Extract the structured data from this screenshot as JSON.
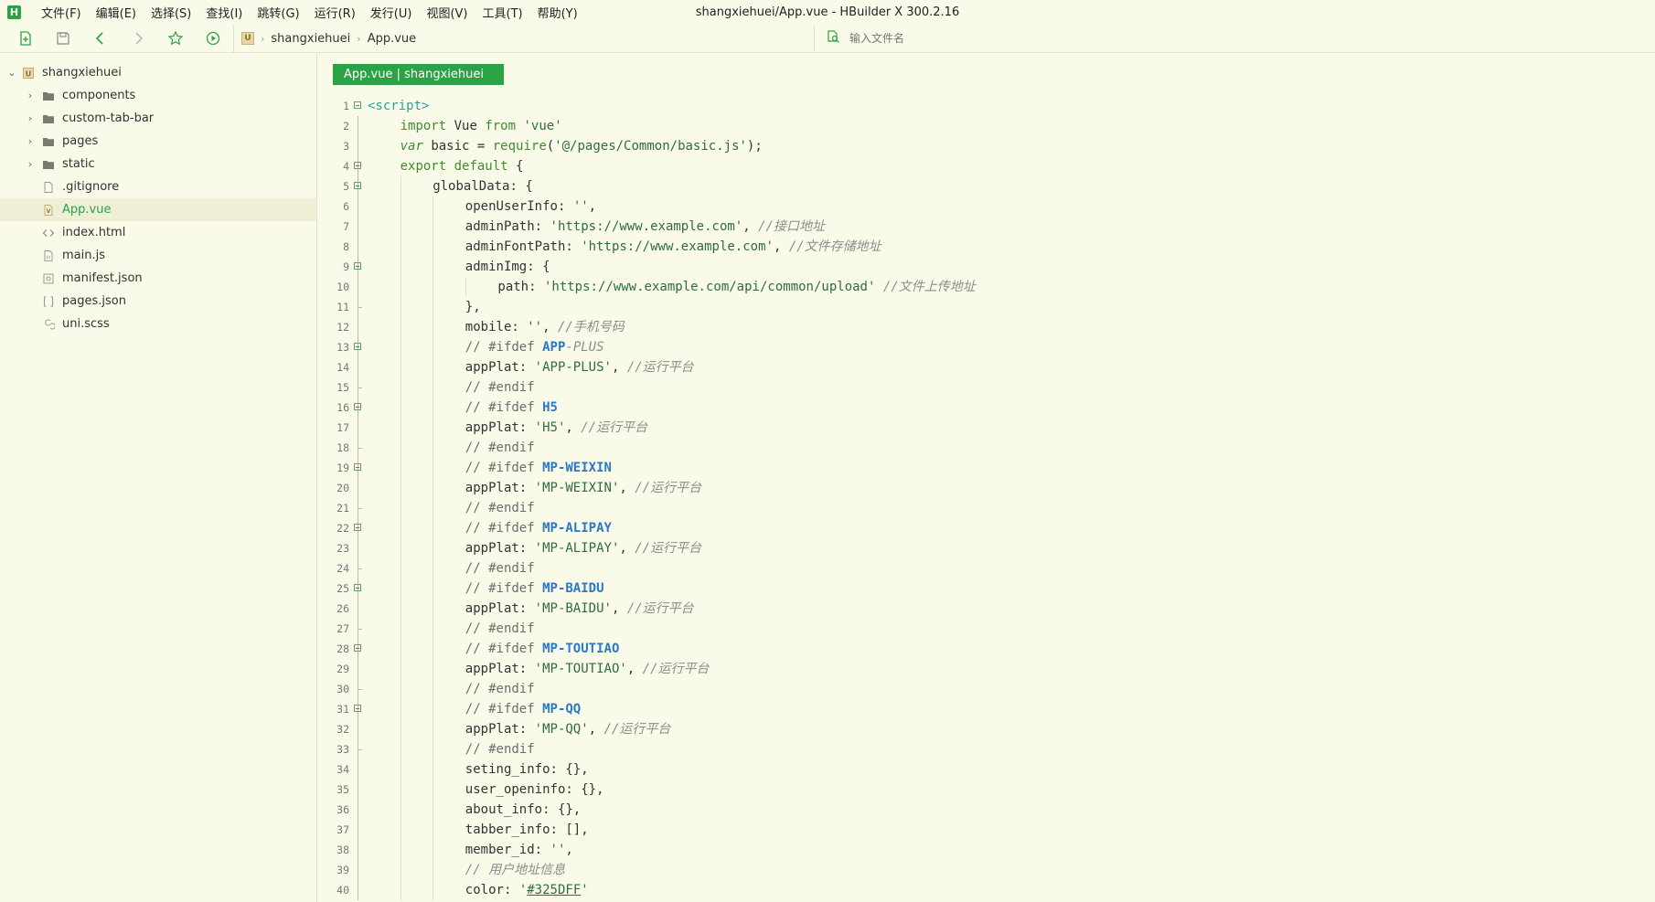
{
  "window": {
    "title": "shangxiehuei/App.vue - HBuilder X 300.2.16",
    "app_logo": "H"
  },
  "menu": [
    "文件(F)",
    "编辑(E)",
    "选择(S)",
    "查找(I)",
    "跳转(G)",
    "运行(R)",
    "发行(U)",
    "视图(V)",
    "工具(T)",
    "帮助(Y)"
  ],
  "toolbar": {
    "breadcrumb": [
      "shangxiehuei",
      "App.vue"
    ],
    "file_search_placeholder": "输入文件名",
    "icons": [
      "new-file-icon",
      "save-icon",
      "back-icon",
      "forward-icon",
      "star-icon",
      "run-icon"
    ]
  },
  "sidebar": {
    "root": "shangxiehuei",
    "items": [
      {
        "label": "components",
        "type": "folder"
      },
      {
        "label": "custom-tab-bar",
        "type": "folder"
      },
      {
        "label": "pages",
        "type": "folder"
      },
      {
        "label": "static",
        "type": "folder"
      },
      {
        "label": ".gitignore",
        "type": "file"
      },
      {
        "label": "App.vue",
        "type": "vue",
        "selected": true
      },
      {
        "label": "index.html",
        "type": "html"
      },
      {
        "label": "main.js",
        "type": "js"
      },
      {
        "label": "manifest.json",
        "type": "json"
      },
      {
        "label": "pages.json",
        "type": "brackets"
      },
      {
        "label": "uni.scss",
        "type": "scss"
      }
    ]
  },
  "editor": {
    "tab_label": "App.vue | shangxiehuei",
    "lines": [
      {
        "n": "1",
        "indent": 0,
        "fold": "start",
        "parts": [
          {
            "t": "<script>",
            "c": "tag"
          }
        ]
      },
      {
        "n": "2",
        "indent": 1,
        "parts": [
          {
            "t": "import",
            "c": "kw"
          },
          {
            "t": " Vue ",
            "c": ""
          },
          {
            "t": "from",
            "c": "kw"
          },
          {
            "t": " 'vue'",
            "c": "str"
          }
        ]
      },
      {
        "n": "3",
        "indent": 1,
        "parts": [
          {
            "t": "var",
            "c": "kwi"
          },
          {
            "t": " basic = ",
            "c": ""
          },
          {
            "t": "require",
            "c": "kw"
          },
          {
            "t": "(",
            "c": ""
          },
          {
            "t": "'@/pages/Common/basic.js'",
            "c": "str"
          },
          {
            "t": ");",
            "c": ""
          }
        ]
      },
      {
        "n": "4",
        "indent": 1,
        "fold": "start",
        "parts": [
          {
            "t": "export default",
            "c": "kw"
          },
          {
            "t": " {",
            "c": ""
          }
        ]
      },
      {
        "n": "5",
        "indent": 2,
        "fold": "start",
        "parts": [
          {
            "t": "globalData: {",
            "c": ""
          }
        ]
      },
      {
        "n": "6",
        "indent": 3,
        "parts": [
          {
            "t": "openUserInfo: ",
            "c": ""
          },
          {
            "t": "''",
            "c": "str"
          },
          {
            "t": ",",
            "c": ""
          }
        ]
      },
      {
        "n": "7",
        "indent": 3,
        "parts": [
          {
            "t": "adminPath: ",
            "c": ""
          },
          {
            "t": "'https://www.example.com'",
            "c": "str"
          },
          {
            "t": ", ",
            "c": ""
          },
          {
            "t": "//接口地址",
            "c": "com"
          }
        ]
      },
      {
        "n": "8",
        "indent": 3,
        "parts": [
          {
            "t": "adminFontPath: ",
            "c": ""
          },
          {
            "t": "'https://www.example.com'",
            "c": "str"
          },
          {
            "t": ", ",
            "c": ""
          },
          {
            "t": "//文件存储地址",
            "c": "com"
          }
        ]
      },
      {
        "n": "9",
        "indent": 3,
        "fold": "start",
        "parts": [
          {
            "t": "adminImg: {",
            "c": ""
          }
        ]
      },
      {
        "n": "10",
        "indent": 4,
        "parts": [
          {
            "t": "path: ",
            "c": ""
          },
          {
            "t": "'https://www.example.com/api/common/upload'",
            "c": "str"
          },
          {
            "t": " ",
            "c": ""
          },
          {
            "t": "//文件上传地址",
            "c": "com"
          }
        ]
      },
      {
        "n": "11",
        "indent": 3,
        "fold": "end",
        "parts": [
          {
            "t": "},",
            "c": ""
          }
        ]
      },
      {
        "n": "12",
        "indent": 3,
        "parts": [
          {
            "t": "mobile: ",
            "c": ""
          },
          {
            "t": "''",
            "c": "str"
          },
          {
            "t": ", ",
            "c": ""
          },
          {
            "t": "//手机号码",
            "c": "com"
          }
        ]
      },
      {
        "n": "13",
        "indent": 3,
        "fold": "start",
        "parts": [
          {
            "t": "// #ifdef ",
            "c": "cpl"
          },
          {
            "t": "APP",
            "c": "bold"
          },
          {
            "t": "-PLUS",
            "c": "com"
          }
        ]
      },
      {
        "n": "14",
        "indent": 3,
        "parts": [
          {
            "t": "appPlat: ",
            "c": ""
          },
          {
            "t": "'APP-PLUS'",
            "c": "str"
          },
          {
            "t": ", ",
            "c": ""
          },
          {
            "t": "//运行平台",
            "c": "com"
          }
        ]
      },
      {
        "n": "15",
        "indent": 3,
        "fold": "end",
        "parts": [
          {
            "t": "// #endif",
            "c": "cpl"
          }
        ]
      },
      {
        "n": "16",
        "indent": 3,
        "fold": "start",
        "parts": [
          {
            "t": "// #ifdef ",
            "c": "cpl"
          },
          {
            "t": "H5",
            "c": "bold"
          }
        ]
      },
      {
        "n": "17",
        "indent": 3,
        "parts": [
          {
            "t": "appPlat: ",
            "c": ""
          },
          {
            "t": "'H5'",
            "c": "str"
          },
          {
            "t": ", ",
            "c": ""
          },
          {
            "t": "//运行平台",
            "c": "com"
          }
        ]
      },
      {
        "n": "18",
        "indent": 3,
        "fold": "end",
        "parts": [
          {
            "t": "// #endif",
            "c": "cpl"
          }
        ]
      },
      {
        "n": "19",
        "indent": 3,
        "fold": "start",
        "parts": [
          {
            "t": "// #ifdef ",
            "c": "cpl"
          },
          {
            "t": "MP-WEIXIN",
            "c": "bold"
          }
        ]
      },
      {
        "n": "20",
        "indent": 3,
        "parts": [
          {
            "t": "appPlat: ",
            "c": ""
          },
          {
            "t": "'MP-WEIXIN'",
            "c": "str"
          },
          {
            "t": ", ",
            "c": ""
          },
          {
            "t": "//运行平台",
            "c": "com"
          }
        ]
      },
      {
        "n": "21",
        "indent": 3,
        "fold": "end",
        "parts": [
          {
            "t": "// #endif",
            "c": "cpl"
          }
        ]
      },
      {
        "n": "22",
        "indent": 3,
        "fold": "start",
        "parts": [
          {
            "t": "// #ifdef ",
            "c": "cpl"
          },
          {
            "t": "MP-ALIPAY",
            "c": "bold"
          }
        ]
      },
      {
        "n": "23",
        "indent": 3,
        "parts": [
          {
            "t": "appPlat: ",
            "c": ""
          },
          {
            "t": "'MP-ALIPAY'",
            "c": "str"
          },
          {
            "t": ", ",
            "c": ""
          },
          {
            "t": "//运行平台",
            "c": "com"
          }
        ]
      },
      {
        "n": "24",
        "indent": 3,
        "fold": "end",
        "parts": [
          {
            "t": "// #endif",
            "c": "cpl"
          }
        ]
      },
      {
        "n": "25",
        "indent": 3,
        "fold": "start",
        "parts": [
          {
            "t": "// #ifdef ",
            "c": "cpl"
          },
          {
            "t": "MP-BAIDU",
            "c": "bold"
          }
        ]
      },
      {
        "n": "26",
        "indent": 3,
        "parts": [
          {
            "t": "appPlat: ",
            "c": ""
          },
          {
            "t": "'MP-BAIDU'",
            "c": "str"
          },
          {
            "t": ", ",
            "c": ""
          },
          {
            "t": "//运行平台",
            "c": "com"
          }
        ]
      },
      {
        "n": "27",
        "indent": 3,
        "fold": "end",
        "parts": [
          {
            "t": "// #endif",
            "c": "cpl"
          }
        ]
      },
      {
        "n": "28",
        "indent": 3,
        "fold": "start",
        "parts": [
          {
            "t": "// #ifdef ",
            "c": "cpl"
          },
          {
            "t": "MP-TOUTIAO",
            "c": "bold"
          }
        ]
      },
      {
        "n": "29",
        "indent": 3,
        "parts": [
          {
            "t": "appPlat: ",
            "c": ""
          },
          {
            "t": "'MP-TOUTIAO'",
            "c": "str"
          },
          {
            "t": ", ",
            "c": ""
          },
          {
            "t": "//运行平台",
            "c": "com"
          }
        ]
      },
      {
        "n": "30",
        "indent": 3,
        "fold": "end",
        "parts": [
          {
            "t": "// #endif",
            "c": "cpl"
          }
        ]
      },
      {
        "n": "31",
        "indent": 3,
        "fold": "start",
        "parts": [
          {
            "t": "// #ifdef ",
            "c": "cpl"
          },
          {
            "t": "MP-QQ",
            "c": "bold"
          }
        ]
      },
      {
        "n": "32",
        "indent": 3,
        "parts": [
          {
            "t": "appPlat: ",
            "c": ""
          },
          {
            "t": "'MP-QQ'",
            "c": "str"
          },
          {
            "t": ", ",
            "c": ""
          },
          {
            "t": "//运行平台",
            "c": "com"
          }
        ]
      },
      {
        "n": "33",
        "indent": 3,
        "fold": "end",
        "parts": [
          {
            "t": "// #endif",
            "c": "cpl"
          }
        ]
      },
      {
        "n": "34",
        "indent": 3,
        "parts": [
          {
            "t": "seting_info: {},",
            "c": ""
          }
        ]
      },
      {
        "n": "35",
        "indent": 3,
        "parts": [
          {
            "t": "user_openinfo: {},",
            "c": ""
          }
        ]
      },
      {
        "n": "36",
        "indent": 3,
        "parts": [
          {
            "t": "about_info: {},",
            "c": ""
          }
        ]
      },
      {
        "n": "37",
        "indent": 3,
        "parts": [
          {
            "t": "tabber_info: [],",
            "c": ""
          }
        ]
      },
      {
        "n": "38",
        "indent": 3,
        "parts": [
          {
            "t": "member_id: ",
            "c": ""
          },
          {
            "t": "''",
            "c": "str"
          },
          {
            "t": ",",
            "c": ""
          }
        ]
      },
      {
        "n": "39",
        "indent": 3,
        "parts": [
          {
            "t": "// 用户地址信息",
            "c": "com"
          }
        ]
      },
      {
        "n": "40",
        "indent": 3,
        "parts": [
          {
            "t": "color: ",
            "c": ""
          },
          {
            "t": "'",
            "c": "str"
          },
          {
            "t": "#325DFF",
            "c": "link"
          },
          {
            "t": "'",
            "c": "str"
          }
        ]
      }
    ]
  },
  "colors": {
    "accent": "#2BA245",
    "background": "#FAFAE8",
    "keyword": "#3C8D2F",
    "string": "#2E6E3A",
    "comment": "#8C8C8C",
    "directive": "#2A78C9"
  }
}
